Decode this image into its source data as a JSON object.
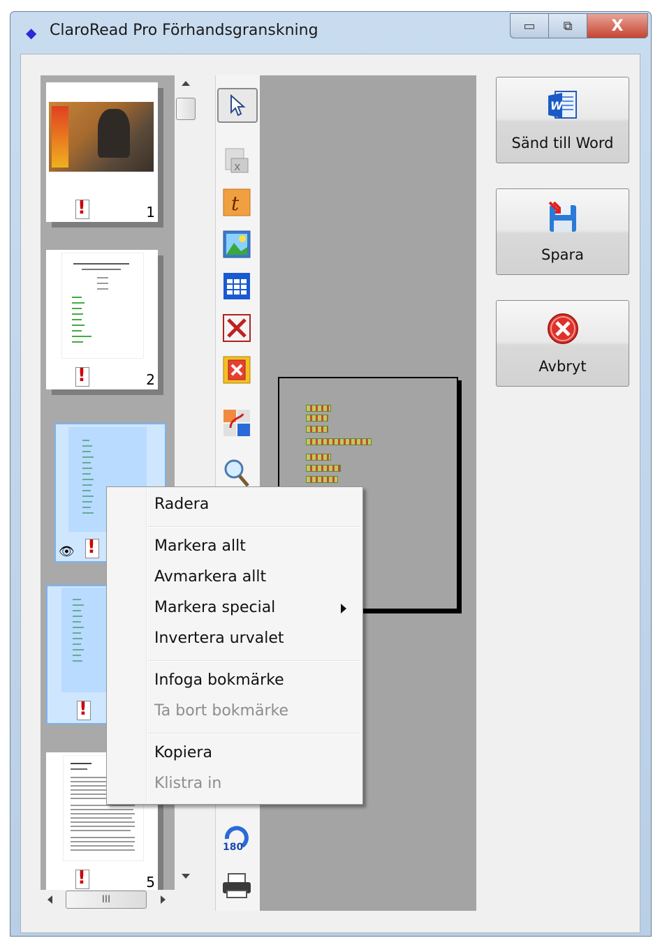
{
  "window": {
    "title": "ClaroRead Pro Förhandsgranskning",
    "controls": {
      "minimize": "▭",
      "maximize": "⧉",
      "close": "X"
    }
  },
  "thumbnails": [
    {
      "page": "1",
      "icon": "exclamation-icon"
    },
    {
      "page": "2",
      "icon": "exclamation-icon"
    },
    {
      "page": "",
      "icon": "exclamation-icon",
      "selected": true
    },
    {
      "page": "",
      "icon": "exclamation-icon",
      "selected": true
    },
    {
      "page": "5",
      "icon": "exclamation-icon"
    }
  ],
  "toolbar": {
    "tools": [
      "pointer-icon",
      "delete-page-icon",
      "text-zone-icon",
      "image-zone-icon",
      "table-zone-icon",
      "delete-zone-icon",
      "delete-all-zones-icon",
      "reorder-zones-icon",
      "zoom-icon",
      "rotate-180-icon",
      "print-icon"
    ],
    "rotate_label": "180"
  },
  "buttons": {
    "send_to_word": "Sänd till Word",
    "save": "Spara",
    "cancel": "Avbryt"
  },
  "context_menu": {
    "items": [
      {
        "label": "Radera",
        "enabled": true
      },
      {
        "label": "Markera allt",
        "enabled": true
      },
      {
        "label": "Avmarkera allt",
        "enabled": true
      },
      {
        "label": "Markera special",
        "enabled": true,
        "submenu": true
      },
      {
        "label": "Invertera urvalet",
        "enabled": true
      },
      {
        "label": "Infoga bokmärke",
        "enabled": true
      },
      {
        "label": "Ta bort bokmärke",
        "enabled": false
      },
      {
        "label": "Kopiera",
        "enabled": true
      },
      {
        "label": "Klistra in",
        "enabled": false
      }
    ]
  },
  "scrollbar": {
    "grip": "III"
  }
}
